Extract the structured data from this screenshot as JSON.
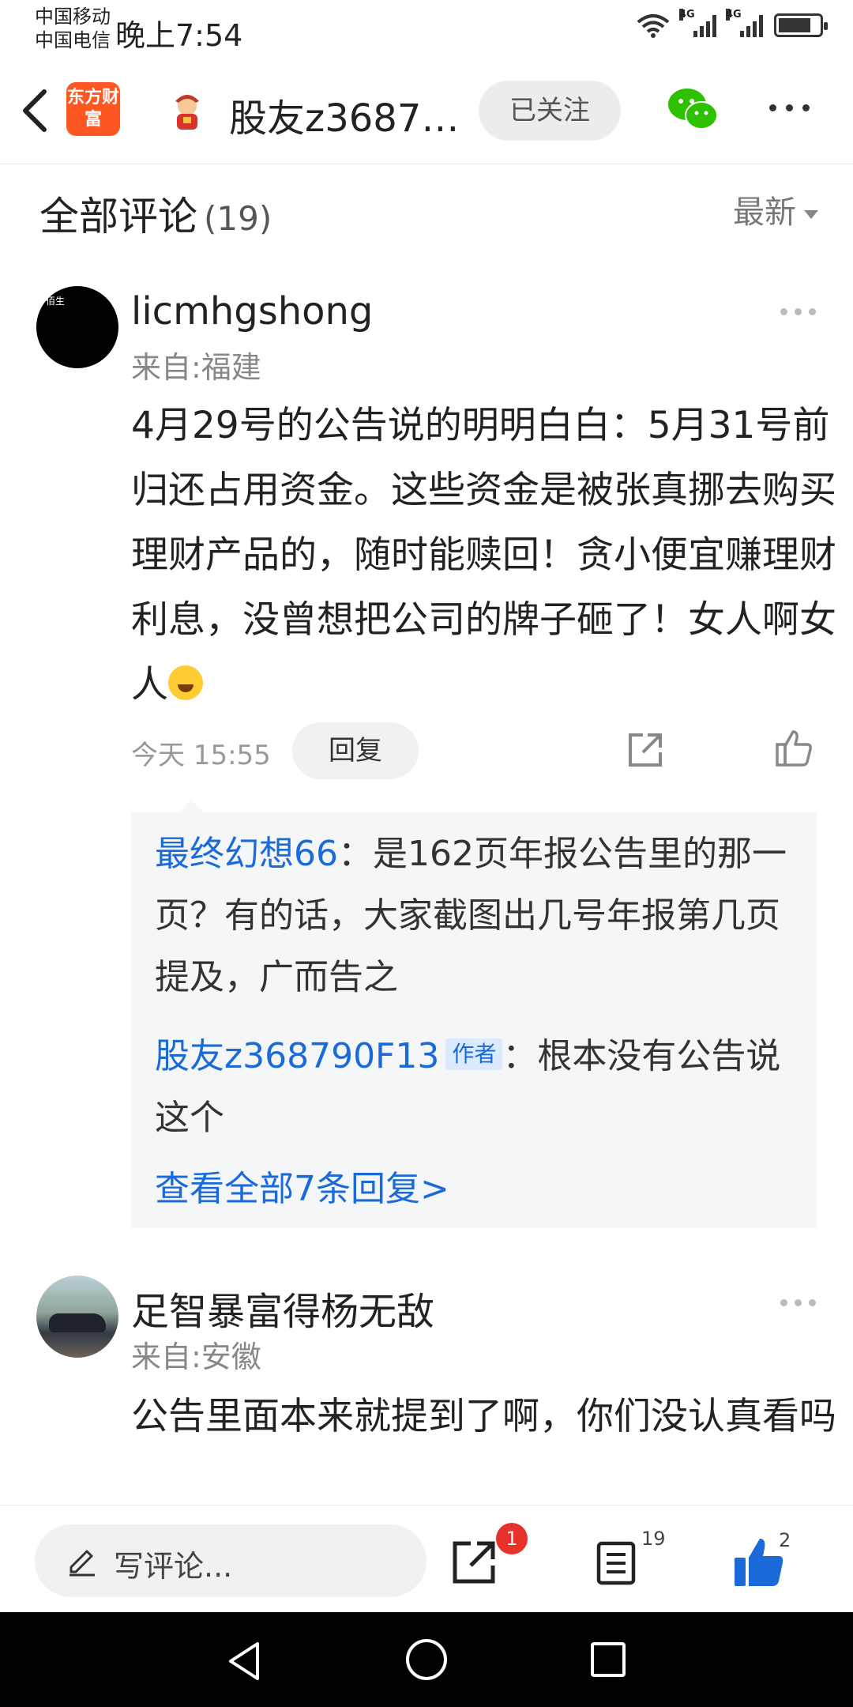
{
  "status_bar": {
    "carrier_1": "中国移动",
    "carrier_2": "中国电信",
    "time": "晚上7:54",
    "signal_tag_1": "4G",
    "signal_tag_2": "4G"
  },
  "header": {
    "app_logo_text": "东方财富",
    "user_title": "股友z3687…",
    "follow_label": "已关注"
  },
  "comments_section": {
    "title": "全部评论",
    "count": "(19)",
    "sort_label": "最新"
  },
  "comments": [
    {
      "username": "licmhgshong",
      "avatar_text": "佰生",
      "location": "来自:福建",
      "text": "4月29号的公告说的明明白白：5月31号前归还占用资金。这些资金是被张真挪去购买理财产品的，随时能赎回！贪小便宜赚理财利息，没曾想把公司的牌子砸了！女人啊女人",
      "time": "今天 15:55",
      "reply_label": "回复",
      "replies": [
        {
          "name": "最终幻想66",
          "text": "：是162页年报公告里的那一页？有的话，大家截图出几号年报第几页提及，广而告之"
        },
        {
          "name": "股友z368790F13",
          "tag": "作者",
          "text": "：根本没有公告说这个"
        }
      ],
      "view_all": "查看全部7条回复>"
    },
    {
      "username": "足智暴富得杨无敌",
      "location": "来自:安徽",
      "text": "公告里面本来就提到了啊，你们没认真看吗"
    }
  ],
  "action_bar": {
    "input_placeholder": "写评论...",
    "share_badge": "1",
    "comment_count": "19",
    "like_count": "2"
  },
  "colors": {
    "link_blue": "#1a6ad9",
    "logo_orange": "#ff5722",
    "wechat_green": "#2dc100",
    "badge_red": "#e8312a",
    "like_blue": "#1a6ad9"
  }
}
